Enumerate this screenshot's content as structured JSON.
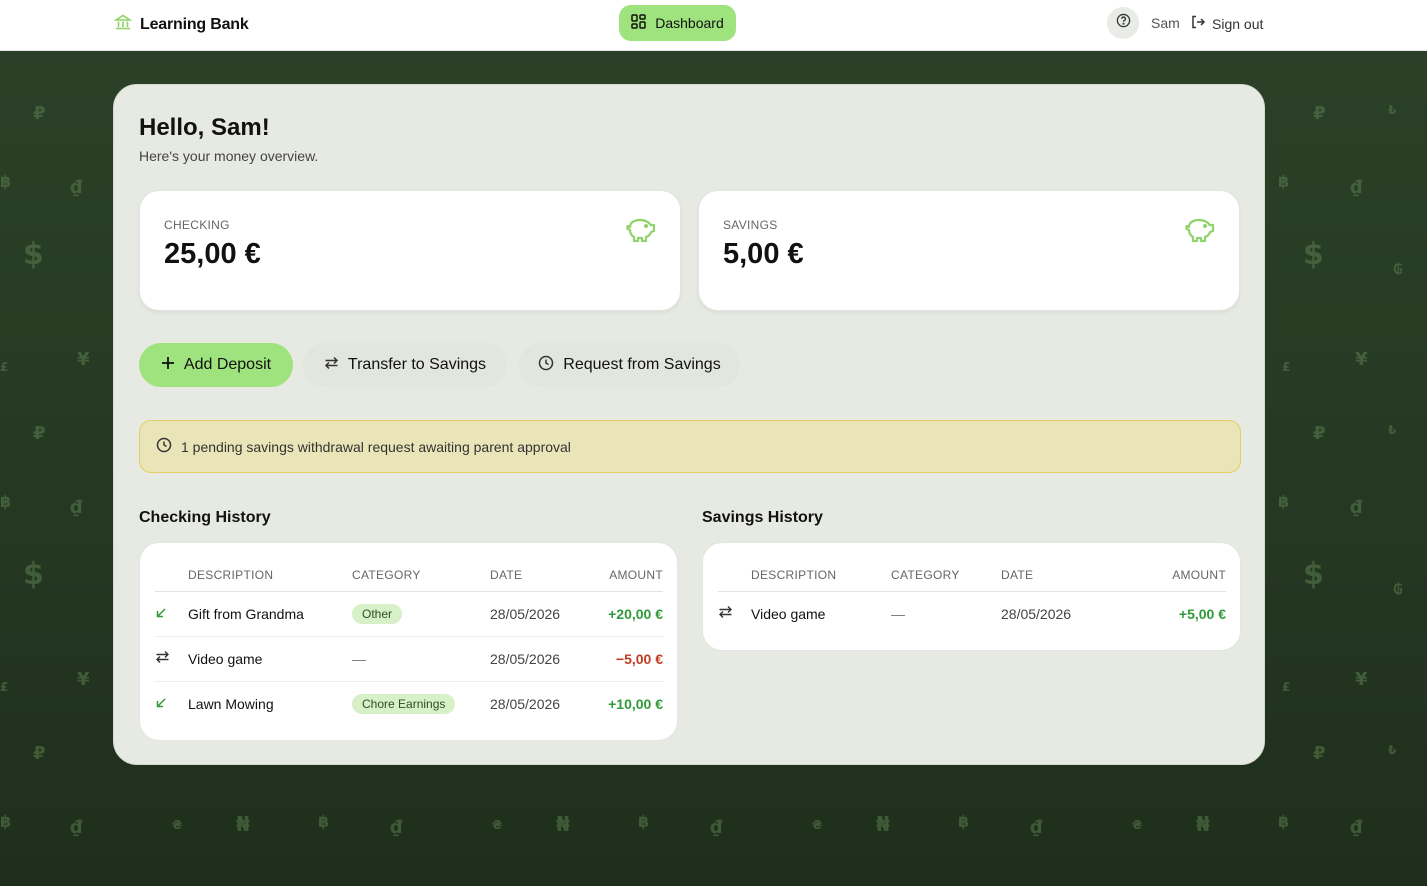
{
  "header": {
    "brand": "Learning Bank",
    "nav_dashboard": "Dashboard",
    "user_name": "Sam",
    "sign_out": "Sign out"
  },
  "greeting": {
    "title": "Hello, Sam!",
    "subtitle": "Here's your money overview."
  },
  "balances": [
    {
      "label": "CHECKING",
      "amount": "25,00 €",
      "icon": "piggy-bank-icon"
    },
    {
      "label": "SAVINGS",
      "amount": "5,00 €",
      "icon": "piggy-bank-icon"
    }
  ],
  "actions": {
    "add_deposit": "Add Deposit",
    "transfer": "Transfer to Savings",
    "request": "Request from Savings"
  },
  "alert": {
    "text": "1 pending savings withdrawal request awaiting parent approval",
    "icon": "clock-icon"
  },
  "checking_history": {
    "title": "Checking History",
    "columns": [
      "DESCRIPTION",
      "CATEGORY",
      "DATE",
      "AMOUNT"
    ],
    "rows": [
      {
        "icon": "deposit-arrow-icon",
        "description": "Gift from Grandma",
        "category": "Other",
        "date": "28/05/2026",
        "amount": "+20,00 €"
      },
      {
        "icon": "transfer-icon",
        "description": "Video game",
        "category": "—",
        "date": "28/05/2026",
        "amount": "−5,00 €"
      },
      {
        "icon": "deposit-arrow-icon",
        "description": "Lawn Mowing",
        "category": "Chore Earnings",
        "date": "28/05/2026",
        "amount": "+10,00 €"
      }
    ]
  },
  "savings_history": {
    "title": "Savings History",
    "columns": [
      "DESCRIPTION",
      "CATEGORY",
      "DATE",
      "AMOUNT"
    ],
    "rows": [
      {
        "icon": "transfer-icon",
        "description": "Video game",
        "category": "—",
        "date": "28/05/2026",
        "amount": "+5,00 €"
      }
    ]
  },
  "colors": {
    "accent": "#9ee37d",
    "background": "#263a23",
    "panel": "#e7eae3",
    "positive": "#2f9a3a",
    "negative": "#c23b22",
    "alert_bg": "#eae5b8"
  }
}
